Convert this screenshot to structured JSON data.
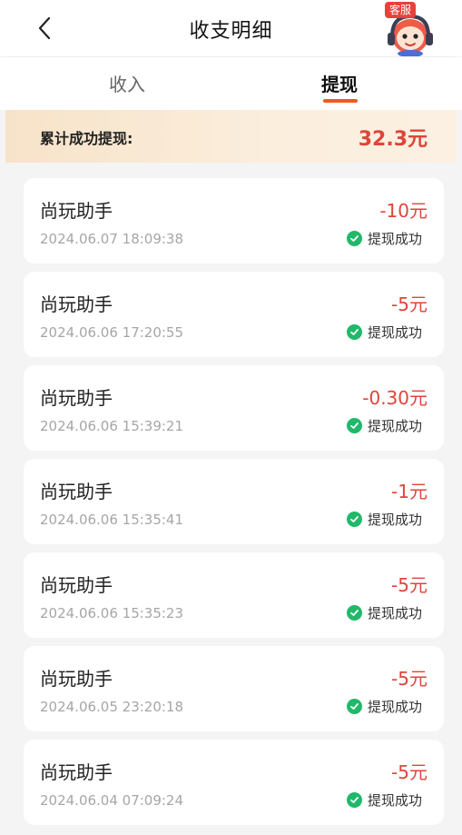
{
  "header": {
    "title": "收支明细",
    "back_icon": "chevron-left-icon",
    "customer_service": {
      "badge": "客服",
      "icon": "customer-service-icon"
    }
  },
  "tabs": [
    {
      "label": "收入",
      "active": false
    },
    {
      "label": "提现",
      "active": true
    }
  ],
  "summary": {
    "label": "累计成功提现:",
    "amount": "32.3元"
  },
  "colors": {
    "accent": "#ee5b1e",
    "amount": "#e0443a",
    "success": "#20b96a"
  },
  "records": [
    {
      "title": "尚玩助手",
      "time": "2024.06.07 18:09:38",
      "amount": "-10元",
      "status": "提现成功"
    },
    {
      "title": "尚玩助手",
      "time": "2024.06.06 17:20:55",
      "amount": "-5元",
      "status": "提现成功"
    },
    {
      "title": "尚玩助手",
      "time": "2024.06.06 15:39:21",
      "amount": "-0.30元",
      "status": "提现成功"
    },
    {
      "title": "尚玩助手",
      "time": "2024.06.06 15:35:41",
      "amount": "-1元",
      "status": "提现成功"
    },
    {
      "title": "尚玩助手",
      "time": "2024.06.06 15:35:23",
      "amount": "-5元",
      "status": "提现成功"
    },
    {
      "title": "尚玩助手",
      "time": "2024.06.05 23:20:18",
      "amount": "-5元",
      "status": "提现成功"
    },
    {
      "title": "尚玩助手",
      "time": "2024.06.04 07:09:24",
      "amount": "-5元",
      "status": "提现成功"
    }
  ]
}
